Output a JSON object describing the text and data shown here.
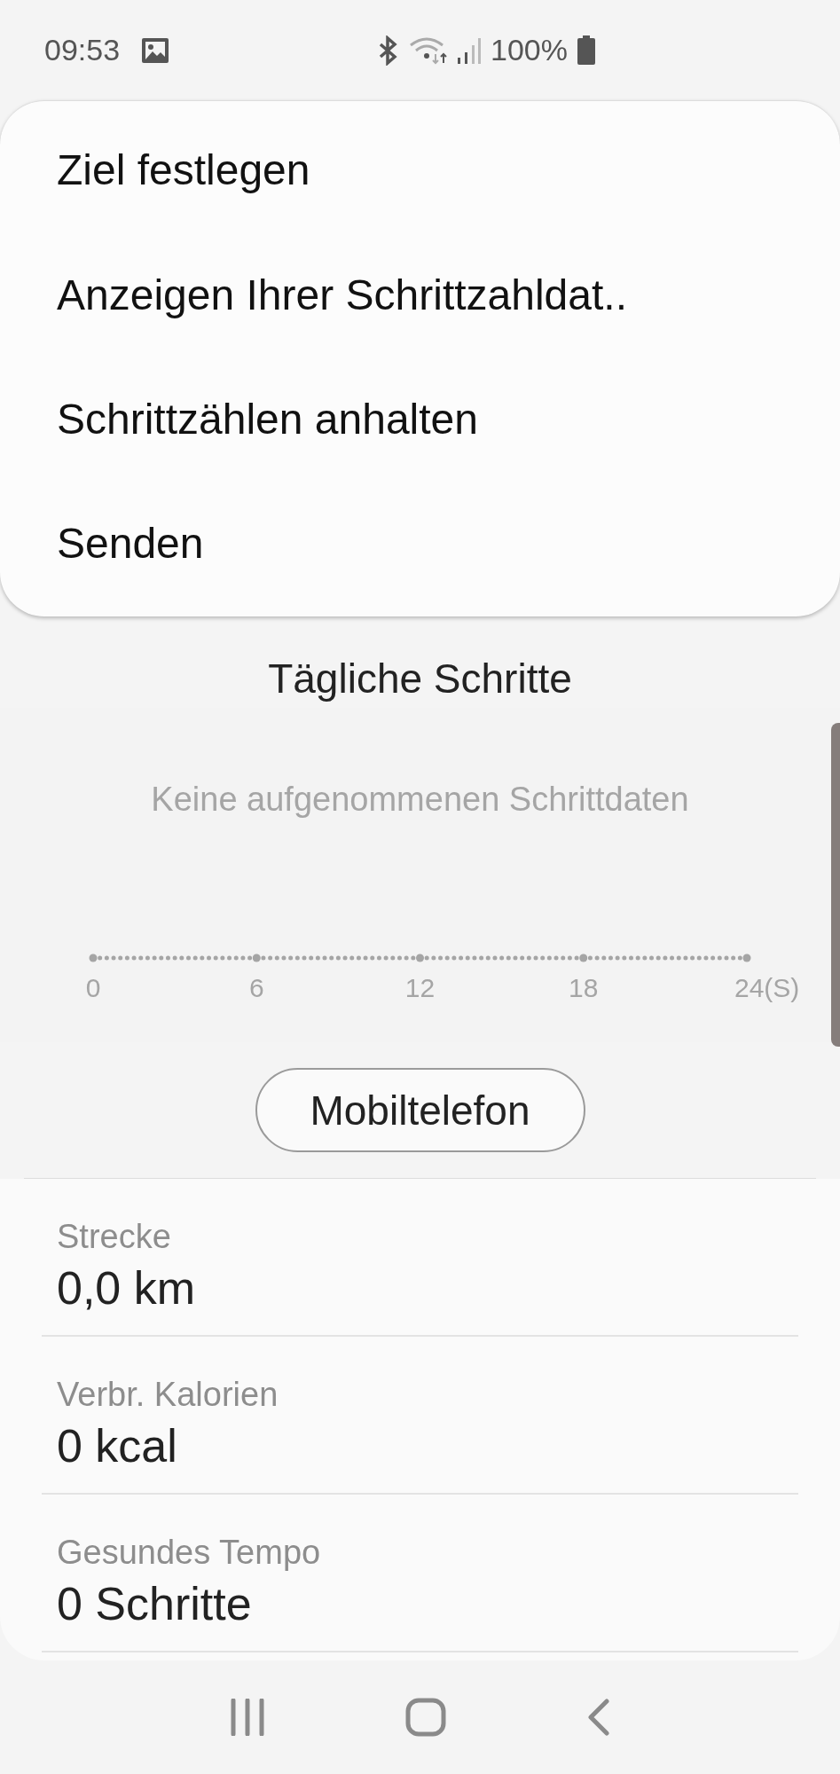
{
  "status_bar": {
    "time": "09:53",
    "battery": "100%"
  },
  "menu": {
    "items": [
      "Ziel festlegen",
      "Anzeigen Ihrer Schrittzahldat..",
      "Schrittzählen anhalten",
      "Senden"
    ]
  },
  "title": "Tägliche Schritte",
  "chart": {
    "empty_message": "Keine aufgenommenen Schrittdaten",
    "axis_labels": [
      "0",
      "6",
      "12",
      "18",
      "24(S)"
    ]
  },
  "source_button": "Mobiltelefon",
  "stats": [
    {
      "label": "Strecke",
      "value": "0,0 km"
    },
    {
      "label": "Verbr. Kalorien",
      "value": "0 kcal"
    },
    {
      "label": "Gesundes Tempo",
      "value": "0 Schritte"
    }
  ]
}
